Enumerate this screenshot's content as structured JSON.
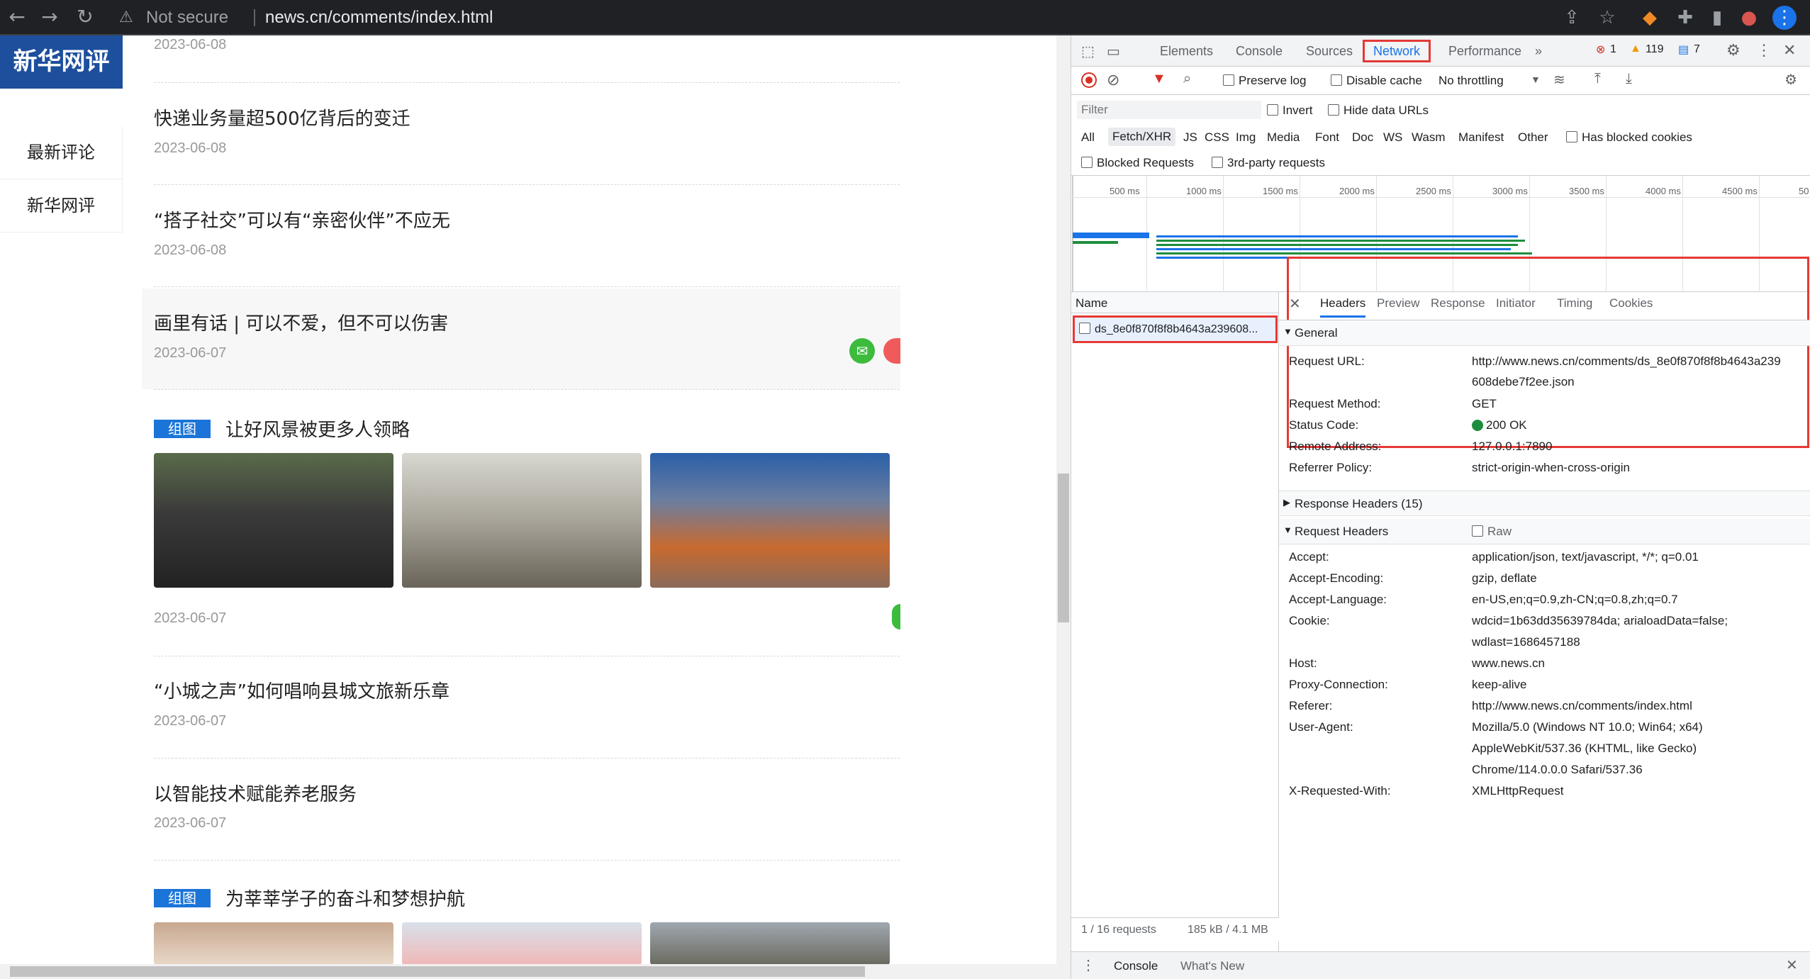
{
  "browser": {
    "back_label": "←",
    "forward_label": "→",
    "reload_label": "↻",
    "security_label": "Not secure",
    "url": "news.cn/comments/index.html"
  },
  "site": {
    "logo_text": "新华网评",
    "side_nav": [
      {
        "label": "最新评论"
      },
      {
        "label": "新华网评"
      }
    ],
    "top_date": "2023-06-08",
    "articles": [
      {
        "title": "快递业务量超500亿背后的变迁",
        "date": "2023-06-08"
      },
      {
        "title": "“搭子社交”可以有“亲密伙伴”不应无",
        "date": "2023-06-08"
      },
      {
        "title": "画里有话 | 可以不爱，但不可以伤害",
        "date": "2023-06-07"
      }
    ],
    "gallery1": {
      "tag": "组图",
      "title": "让好风景被更多人领略",
      "date": "2023-06-07"
    },
    "articles2": [
      {
        "title": "“小城之声”如何唱响县城文旅新乐章",
        "date": "2023-06-07"
      },
      {
        "title": "以智能技术赋能养老服务",
        "date": "2023-06-07"
      }
    ],
    "gallery2": {
      "tag": "组图",
      "title": "为莘莘学子的奋斗和梦想护航"
    }
  },
  "devtools": {
    "tabs": [
      "Elements",
      "Console",
      "Sources",
      "Network",
      "Performance",
      "»"
    ],
    "active_tab": "Network",
    "errors": "1",
    "warnings": "119",
    "messages": "7",
    "toolbar": {
      "preserve_log": "Preserve log",
      "disable_cache": "Disable cache",
      "throttling": "No throttling"
    },
    "filter": {
      "placeholder": "Filter",
      "invert": "Invert",
      "hide_data_urls": "Hide data URLs",
      "types": [
        "All",
        "Fetch/XHR",
        "JS",
        "CSS",
        "Img",
        "Media",
        "Font",
        "Doc",
        "WS",
        "Wasm",
        "Manifest",
        "Other"
      ],
      "has_blocked_cookies": "Has blocked cookies",
      "blocked_requests": "Blocked Requests",
      "third_party": "3rd-party requests"
    },
    "timeline_ticks": [
      "500 ms",
      "1000 ms",
      "1500 ms",
      "2000 ms",
      "2500 ms",
      "3000 ms",
      "3500 ms",
      "4000 ms",
      "4500 ms",
      "50"
    ],
    "name_header": "Name",
    "request_name": "ds_8e0f870f8f8b4643a239608...",
    "status_bar": {
      "requests": "1 / 16 requests",
      "transferred": "185 kB / 4.1 MB"
    },
    "detail_tabs": [
      "Headers",
      "Preview",
      "Response",
      "Initiator",
      "Timing",
      "Cookies"
    ],
    "general": {
      "title": "General",
      "rows": [
        {
          "k": "Request URL:",
          "v": "http://www.news.cn/comments/ds_8e0f870f8f8b4643a239",
          "v2": "608debe7f2ee.json"
        },
        {
          "k": "Request Method:",
          "v": "GET"
        },
        {
          "k": "Status Code:",
          "v": "200 OK"
        },
        {
          "k": "Remote Address:",
          "v": "127.0.0.1:7890"
        },
        {
          "k": "Referrer Policy:",
          "v": "strict-origin-when-cross-origin"
        }
      ]
    },
    "response_headers": "Response Headers (15)",
    "request_headers": {
      "title": "Request Headers",
      "raw": "Raw",
      "rows": [
        {
          "k": "Accept:",
          "v": "application/json, text/javascript, */*; q=0.01"
        },
        {
          "k": "Accept-Encoding:",
          "v": "gzip, deflate"
        },
        {
          "k": "Accept-Language:",
          "v": "en-US,en;q=0.9,zh-CN;q=0.8,zh;q=0.7"
        },
        {
          "k": "Cookie:",
          "v": "wdcid=1b63dd35639784da; arialoadData=false;",
          "v2": "wdlast=1686457188"
        },
        {
          "k": "Host:",
          "v": "www.news.cn"
        },
        {
          "k": "Proxy-Connection:",
          "v": "keep-alive"
        },
        {
          "k": "Referer:",
          "v": "http://www.news.cn/comments/index.html"
        },
        {
          "k": "User-Agent:",
          "v": "Mozilla/5.0 (Windows NT 10.0; Win64; x64)",
          "v2": "AppleWebKit/537.36 (KHTML, like Gecko)",
          "v3": "Chrome/114.0.0.0 Safari/537.36"
        },
        {
          "k": "X-Requested-With:",
          "v": "XMLHttpRequest"
        }
      ]
    },
    "drawer": {
      "console": "Console",
      "whats_new": "What's New"
    }
  },
  "colors": {
    "accent": "#1a73e8",
    "highlight": "#e53935",
    "brand": "#1d4f9c"
  }
}
